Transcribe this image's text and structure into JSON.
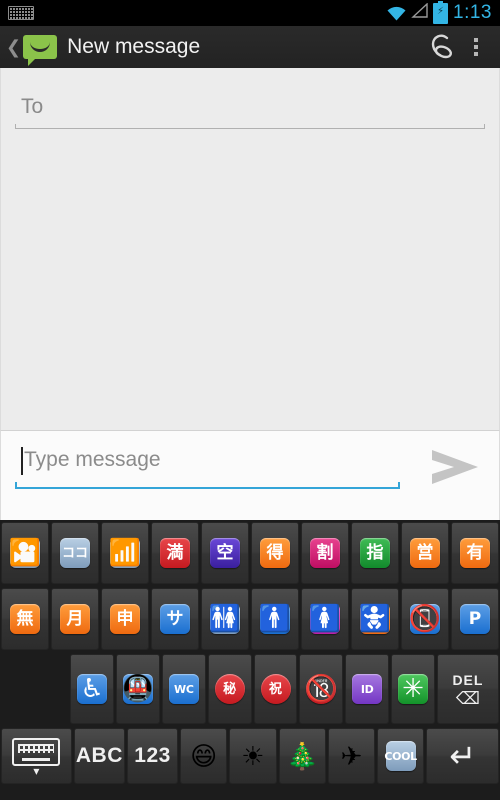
{
  "statusbar": {
    "notification_icon": "keyboard-icon",
    "wifi_icon": "wifi-icon",
    "signal_icon": "cell-signal-icon",
    "battery_icon": "battery-charging-icon",
    "time": "1:13",
    "accent_color": "#33b5e5"
  },
  "actionbar": {
    "back_icon": "back-chevron-icon",
    "app_icon": "sms-bubble-icon",
    "title": "New message",
    "attach_icon": "paperclip-icon",
    "overflow_icon": "overflow-menu-icon",
    "app_icon_color": "#8bc34a"
  },
  "compose": {
    "to_placeholder": "To",
    "to_value": "",
    "message_placeholder": "Type message",
    "message_value": "",
    "send_icon": "send-arrow-icon",
    "focus_color": "#34a5d8"
  },
  "keyboard": {
    "rows": [
      {
        "id": "emoji-row-1",
        "keys": [
          {
            "name": "emoji-cinema",
            "glyph": "🎦",
            "label": "",
            "style": "c-steel",
            "shape": "sq",
            "size": "glyph"
          },
          {
            "name": "emoji-koko-here",
            "glyph": "",
            "label": "ココ",
            "style": "c-steel",
            "shape": "sq",
            "size": "small"
          },
          {
            "name": "emoji-signal-strength",
            "glyph": "📶",
            "label": "",
            "style": "c-steel",
            "shape": "sq",
            "size": "glyph"
          },
          {
            "name": "emoji-man-full",
            "glyph": "",
            "label": "満",
            "style": "c-red",
            "shape": "sq",
            "size": ""
          },
          {
            "name": "emoji-vacancy",
            "glyph": "",
            "label": "空",
            "style": "c-purple",
            "shape": "sq",
            "size": ""
          },
          {
            "name": "emoji-bargain",
            "glyph": "",
            "label": "得",
            "style": "c-orange",
            "shape": "sq",
            "size": ""
          },
          {
            "name": "emoji-discount",
            "glyph": "",
            "label": "割",
            "style": "c-magenta",
            "shape": "sq",
            "size": ""
          },
          {
            "name": "emoji-reserved",
            "glyph": "",
            "label": "指",
            "style": "c-green",
            "shape": "sq",
            "size": ""
          },
          {
            "name": "emoji-open-for-business",
            "glyph": "",
            "label": "営",
            "style": "c-orange",
            "shape": "sq",
            "size": ""
          },
          {
            "name": "emoji-not-free-of-charge",
            "glyph": "",
            "label": "有",
            "style": "c-orange",
            "shape": "sq",
            "size": ""
          }
        ]
      },
      {
        "id": "emoji-row-2",
        "keys": [
          {
            "name": "emoji-free-of-charge",
            "glyph": "",
            "label": "無",
            "style": "c-orange",
            "shape": "sq",
            "size": ""
          },
          {
            "name": "emoji-monthly-amount",
            "glyph": "",
            "label": "月",
            "style": "c-orange",
            "shape": "sq",
            "size": ""
          },
          {
            "name": "emoji-application",
            "glyph": "",
            "label": "申",
            "style": "c-orange",
            "shape": "sq",
            "size": ""
          },
          {
            "name": "emoji-service-charge",
            "glyph": "",
            "label": "サ",
            "style": "c-blue2",
            "shape": "sq",
            "size": ""
          },
          {
            "name": "emoji-restroom",
            "glyph": "🚻",
            "label": "",
            "style": "c-steel",
            "shape": "sq",
            "size": "glyph"
          },
          {
            "name": "emoji-mens-room",
            "glyph": "🚹",
            "label": "",
            "style": "c-blue2",
            "shape": "sq",
            "size": "glyph"
          },
          {
            "name": "emoji-womens-room",
            "glyph": "🚺",
            "label": "",
            "style": "c-pink",
            "shape": "sq",
            "size": "glyph"
          },
          {
            "name": "emoji-baby-symbol",
            "glyph": "🚼",
            "label": "",
            "style": "c-orange",
            "shape": "sq",
            "size": "glyph"
          },
          {
            "name": "emoji-no-mobile-phones",
            "glyph": "📵",
            "label": "",
            "style": "c-blue2",
            "shape": "sq",
            "size": "glyph"
          },
          {
            "name": "emoji-parking",
            "glyph": "",
            "label": "P",
            "style": "c-blue2",
            "shape": "sq",
            "size": ""
          }
        ]
      },
      {
        "id": "emoji-row-3",
        "keys": [
          {
            "name": "emoji-wheelchair",
            "glyph": "♿",
            "label": "",
            "style": "c-blue2",
            "shape": "sq",
            "size": "glyph"
          },
          {
            "name": "emoji-metro",
            "glyph": "🚇",
            "label": "",
            "style": "c-blue2",
            "shape": "sq",
            "size": "glyph"
          },
          {
            "name": "emoji-water-closet",
            "glyph": "",
            "label": "WC",
            "style": "c-blue2",
            "shape": "sq",
            "size": "tiny"
          },
          {
            "name": "emoji-secret",
            "glyph": "",
            "label": "秘",
            "style": "c-red",
            "shape": "circ",
            "size": "small"
          },
          {
            "name": "emoji-congratulations",
            "glyph": "",
            "label": "祝",
            "style": "c-red",
            "shape": "circ",
            "size": "small"
          },
          {
            "name": "emoji-no-one-under-eighteen",
            "glyph": "🔞",
            "label": "",
            "style": "c-red",
            "shape": "circ",
            "size": "glyph"
          },
          {
            "name": "emoji-id-button",
            "glyph": "",
            "label": "ID",
            "style": "c-violet",
            "shape": "sq",
            "size": "tiny"
          },
          {
            "name": "emoji-eight-spoked-asterisk",
            "glyph": "✳",
            "label": "",
            "style": "c-green2",
            "shape": "sq",
            "size": "glyph"
          }
        ],
        "delete_key": {
          "name": "delete-key",
          "label": "DEL",
          "icon": "backspace-icon"
        }
      },
      {
        "id": "function-row",
        "keys": [
          {
            "name": "hide-keyboard-key",
            "label": "",
            "icon": "keyboard-hide-icon"
          },
          {
            "name": "abc-key",
            "label": "ABC",
            "icon": ""
          },
          {
            "name": "numeric-key",
            "label": "123",
            "icon": ""
          },
          {
            "name": "emoji-category-smileys",
            "label": "",
            "icon": "😄"
          },
          {
            "name": "emoji-category-nature",
            "label": "",
            "icon": "☀"
          },
          {
            "name": "emoji-category-celebration",
            "label": "",
            "icon": "🎄"
          },
          {
            "name": "emoji-category-travel",
            "label": "",
            "icon": "✈"
          },
          {
            "name": "emoji-category-symbols",
            "label": "COOL",
            "icon": ""
          },
          {
            "name": "enter-key",
            "label": "",
            "icon": "return-icon"
          }
        ]
      }
    ]
  }
}
